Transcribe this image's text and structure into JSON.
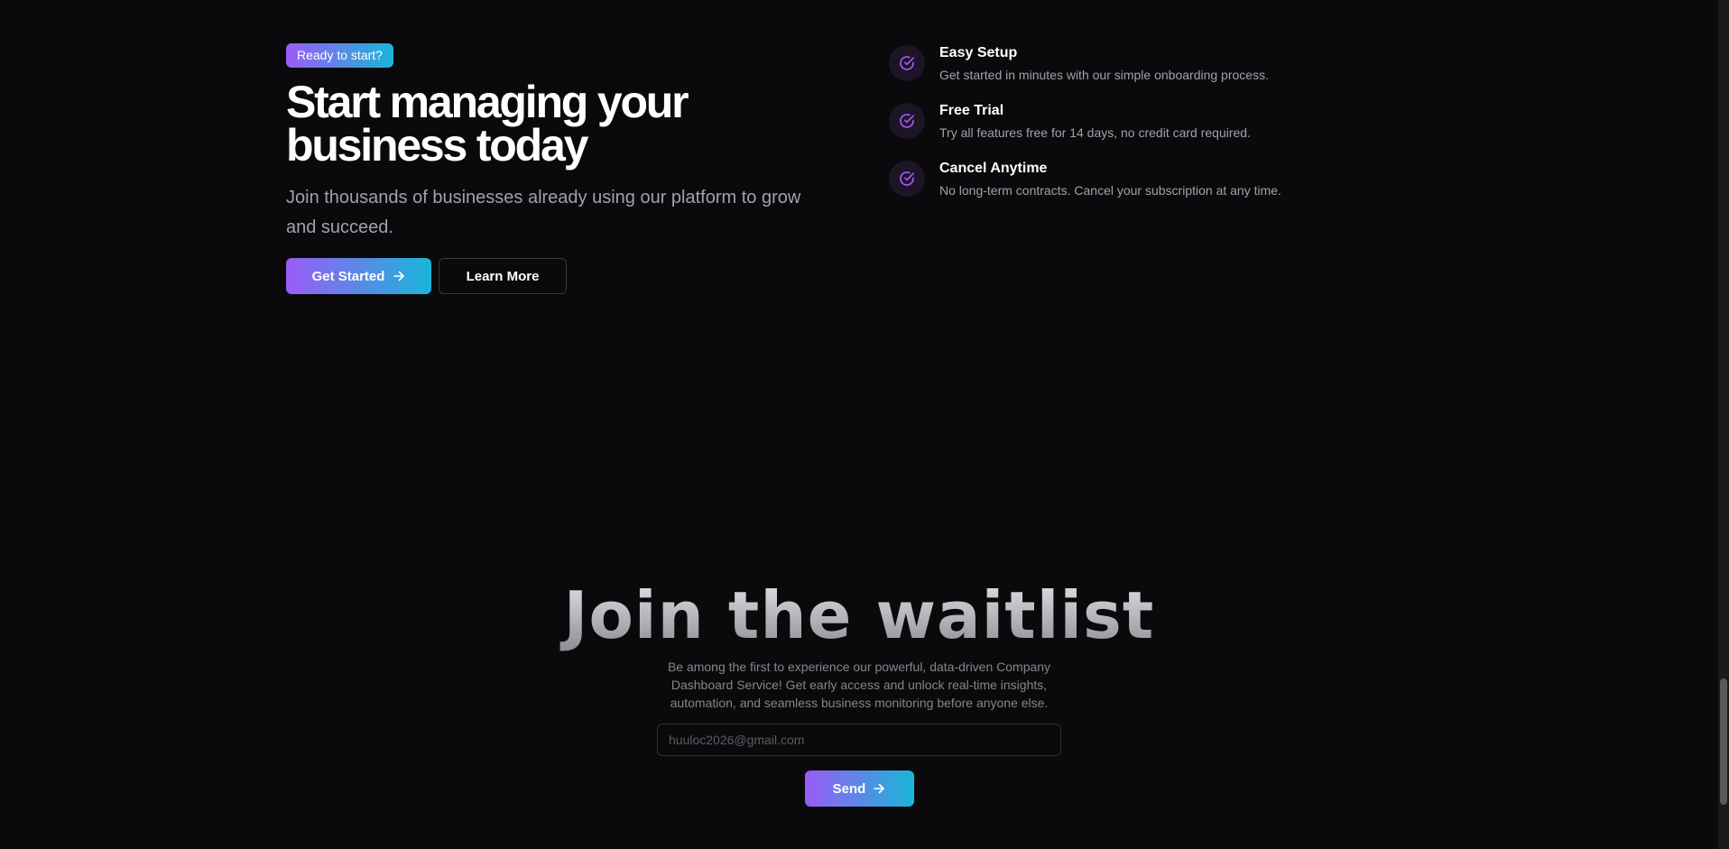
{
  "cta": {
    "badge": "Ready to start?",
    "title_line1": "Start managing your",
    "title_line2": "business today",
    "subtitle": "Join thousands of businesses already using our platform to grow and succeed.",
    "primary_button": "Get Started",
    "secondary_button": "Learn More"
  },
  "features": [
    {
      "icon": "check-circle-icon",
      "title": "Easy Setup",
      "description": "Get started in minutes with our simple onboarding process."
    },
    {
      "icon": "check-circle-icon",
      "title": "Free Trial",
      "description": "Try all features free for 14 days, no credit card required."
    },
    {
      "icon": "check-circle-icon",
      "title": "Cancel Anytime",
      "description": "No long-term contracts. Cancel your subscription at any time."
    }
  ],
  "waitlist": {
    "title": "Join the waitlist",
    "description": "Be among the first to experience our powerful, data-driven Company Dashboard Service! Get early access and unlock real-time insights, automation, and seamless business monitoring before anyone else.",
    "email_placeholder": "huuloc2026@gmail.com",
    "send_button": "Send"
  },
  "colors": {
    "background": "#0a0a0c",
    "gradient_start": "#9b5cf6",
    "gradient_end": "#19b6d8",
    "accent_purple": "#a855f7",
    "muted_text": "#a1a1aa"
  }
}
